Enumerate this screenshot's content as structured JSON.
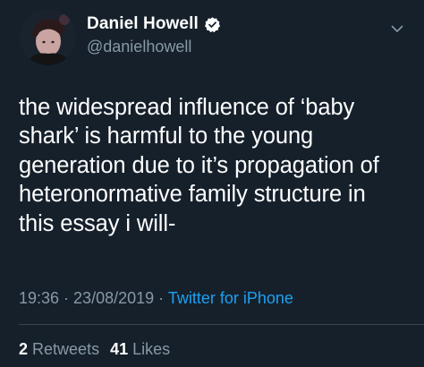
{
  "author": {
    "display_name": "Daniel Howell",
    "handle": "@danielhowell",
    "verified": true,
    "avatar_icon": "profile-photo"
  },
  "tweet": {
    "lines": [
      "the widespread influence of ‘baby",
      "shark’ is harmful to the young",
      "generation due to it’s propagation of",
      "heteronormative family structure in",
      "this essay i will-"
    ]
  },
  "meta": {
    "time": "19:36",
    "sep1": " · ",
    "date": "23/08/2019",
    "sep2": " · ",
    "source": "Twitter for iPhone"
  },
  "stats": {
    "retweets_count": "2",
    "retweets_label": "Retweets",
    "likes_count": "41",
    "likes_label": "Likes"
  },
  "colors": {
    "background": "#15202b",
    "text": "#ffffff",
    "secondary": "#8899a6",
    "link": "#1da1f2",
    "divider": "#38444d"
  },
  "icons": {
    "verified": "verified-badge-icon",
    "menu": "chevron-down-icon"
  }
}
